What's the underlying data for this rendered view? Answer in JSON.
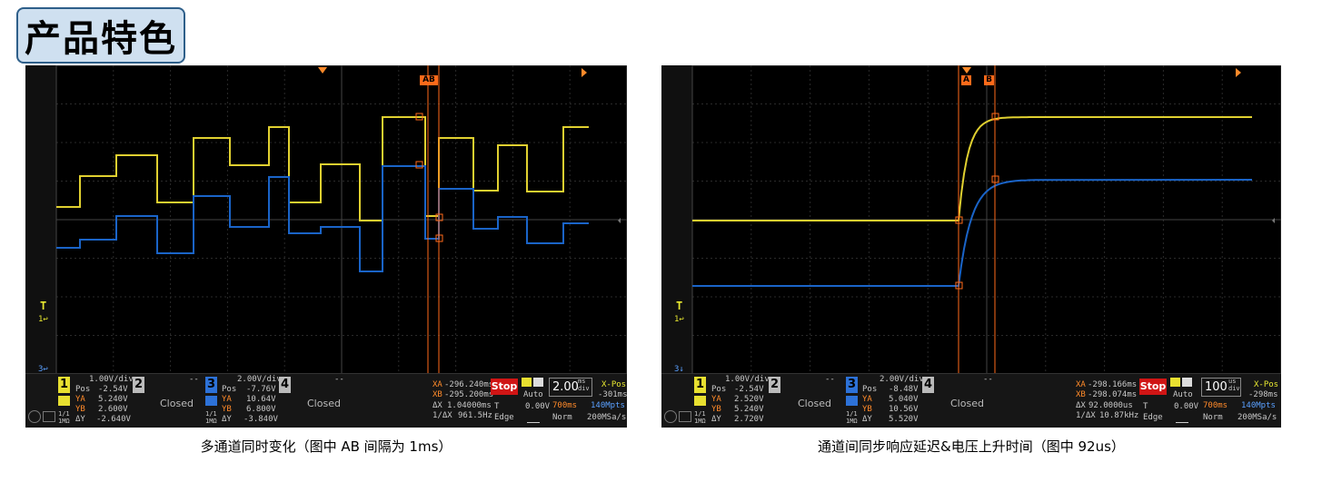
{
  "title": "产品特色",
  "colors": {
    "ch1": "#e0d030",
    "ch3": "#1a64c8",
    "cursor": "#ff6a1a",
    "stop": "#d01515",
    "title_bg": "#cfe0f0"
  },
  "scope1": {
    "caption": "多通道同时变化（图中 AB 间隔为 1ms）",
    "cursor_tag": "AB",
    "trig_marker": "T",
    "trig_sub": "1",
    "ch3_marker": "3",
    "ch1": {
      "num": "1",
      "scale": "1.00V/div",
      "pos_label": "Pos",
      "pos": "-2.54V",
      "ya_label": "YA",
      "ya": "5.240V",
      "yb_label": "YB",
      "yb": "2.600V",
      "dy_label": "ΔY",
      "dy": "-2.640V",
      "imp": "1/1 1MΩ"
    },
    "ch2": {
      "num": "2",
      "state": "Closed",
      "dash": "--"
    },
    "ch3": {
      "num": "3",
      "scale": "2.00V/div",
      "pos_label": "Pos",
      "pos": "-7.76V",
      "ya_label": "YA",
      "ya": "10.64V",
      "yb_label": "YB",
      "yb": "6.800V",
      "dy_label": "ΔY",
      "dy": "-3.840V",
      "imp": "1/1 1MΩ"
    },
    "ch4": {
      "num": "4",
      "state": "Closed",
      "dash": "--"
    },
    "cursors": {
      "xa_label": "XA",
      "xa": "-296.240ms",
      "xb_label": "XB",
      "xb": "-295.200ms",
      "dx_label": "ΔX",
      "dx": "1.04000ms",
      "idx_label": "1/ΔX",
      "idx": "961.5Hz"
    },
    "run": {
      "state": "Stop",
      "mode": "Auto",
      "t_label": "T",
      "t_val": "0.00V",
      "trig_type": "Edge"
    },
    "timebase": {
      "value": "2.00",
      "unit_top": "ms",
      "unit_bot": "div",
      "xpos_label": "X-Pos",
      "xpos": "-301ms",
      "mem": "700ms",
      "depth": "140Mpts",
      "acq": "Norm",
      "rate": "200MSa/s"
    }
  },
  "scope2": {
    "caption": "通道间同步响应延迟&电压上升时间（图中 92us）",
    "cursor_a": "A",
    "cursor_b": "B",
    "trig_marker": "T",
    "trig_sub": "1",
    "ch3_marker": "3",
    "ch1": {
      "num": "1",
      "scale": "1.00V/div",
      "pos_label": "Pos",
      "pos": "-2.54V",
      "ya_label": "YA",
      "ya": "2.520V",
      "yb_label": "YB",
      "yb": "5.240V",
      "dy_label": "ΔY",
      "dy": "2.720V",
      "imp": "1/1 1MΩ"
    },
    "ch2": {
      "num": "2",
      "state": "Closed",
      "dash": "--"
    },
    "ch3": {
      "num": "3",
      "scale": "2.00V/div",
      "pos_label": "Pos",
      "pos": "-8.48V",
      "ya_label": "YA",
      "ya": "5.040V",
      "yb_label": "YB",
      "yb": "10.56V",
      "dy_label": "ΔY",
      "dy": "5.520V",
      "imp": "1/1 1MΩ"
    },
    "ch4": {
      "num": "4",
      "state": "Closed",
      "dash": "--"
    },
    "cursors": {
      "xa_label": "XA",
      "xa": "-298.166ms",
      "xb_label": "XB",
      "xb": "-298.074ms",
      "dx_label": "ΔX",
      "dx": "92.0000us",
      "idx_label": "1/ΔX",
      "idx": "10.87kHz"
    },
    "run": {
      "state": "Stop",
      "mode": "Auto",
      "t_label": "T",
      "t_val": "0.00V",
      "trig_type": "Edge"
    },
    "timebase": {
      "value": "100",
      "unit_top": "us",
      "unit_bot": "div",
      "xpos_label": "X-Pos",
      "xpos": "-298ms",
      "mem": "700ms",
      "depth": "140Mpts",
      "acq": "Norm",
      "rate": "200MSa/s"
    }
  }
}
